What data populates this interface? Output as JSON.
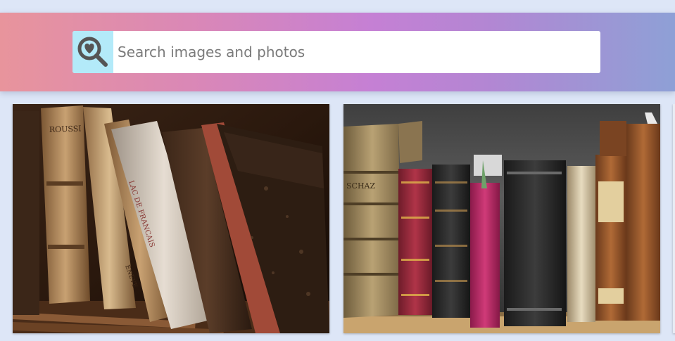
{
  "search": {
    "placeholder": "Search images and photos",
    "icon": "heart-search-icon",
    "icon_bg": "#b3eaf9",
    "icon_color": "#555555"
  },
  "header": {
    "gradient": [
      "#e8949c",
      "#c580d4",
      "#8ea0d6"
    ]
  },
  "gallery": {
    "images": [
      {
        "name": "antique-books-leaning",
        "photo_text": [
          "ROUSSI",
          "ÉNÉVE",
          "LAC DE FRANCAIS"
        ]
      },
      {
        "name": "antique-books-shelf",
        "photo_text": [
          "SCHAZ"
        ]
      }
    ]
  }
}
